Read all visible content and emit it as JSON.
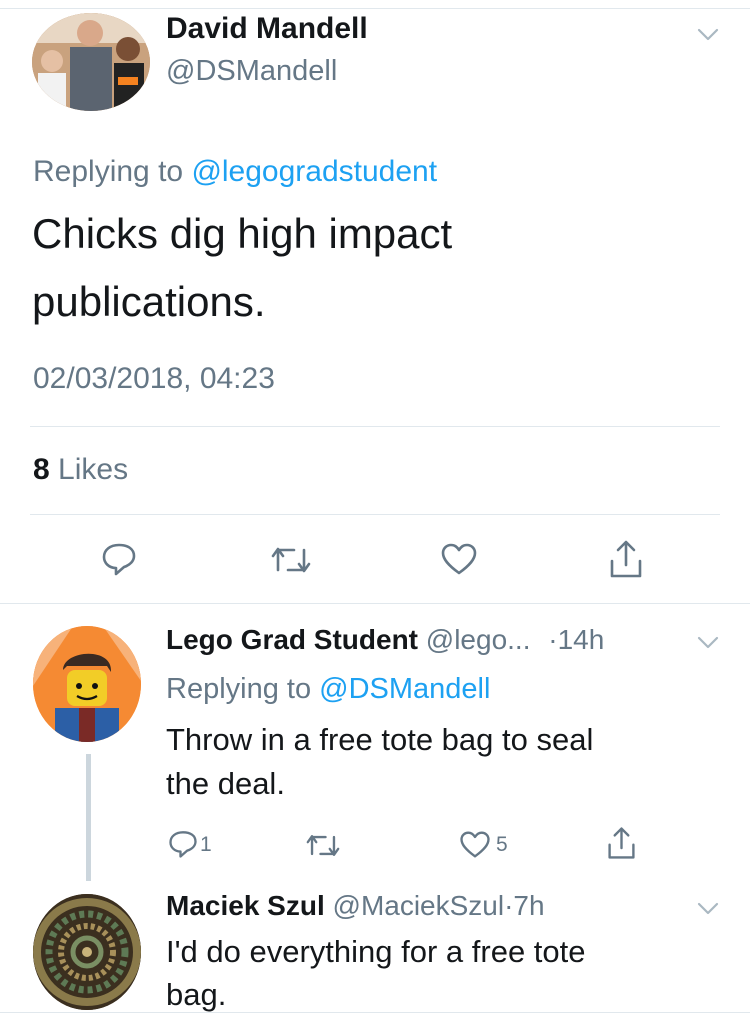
{
  "main_tweet": {
    "author_name": "David Mandell",
    "author_handle": "@DSMandell",
    "replying_prefix": "Replying to",
    "replying_to": "@legogradstudent",
    "text_line1": "Chicks dig high impact",
    "text_line2": "publications.",
    "timestamp": "02/03/2018, 04:23",
    "likes_count": "8",
    "likes_label": "Likes",
    "actions": [
      "reply-icon",
      "retweet-icon",
      "like-icon",
      "share-icon"
    ]
  },
  "replies": [
    {
      "author_name": "Lego Grad Student",
      "author_handle": "@lego...",
      "time": "·14h",
      "replying_prefix": "Replying to",
      "replying_to": "@DSMandell",
      "text_line1": "Throw in a free tote bag to seal",
      "text_line2": "the deal.",
      "reply_count": "1",
      "like_count": "5"
    },
    {
      "author_name": "Maciek Szul",
      "author_handle": "@MaciekSzul",
      "time": "·7h",
      "text_line1": "I'd do everything for a free tote",
      "text_line2": "bag."
    }
  ],
  "colors": {
    "accent": "#1da1f2",
    "secondary_text": "#657786",
    "divider": "#e1e8ed",
    "thread_line": "#ccd6dd"
  }
}
